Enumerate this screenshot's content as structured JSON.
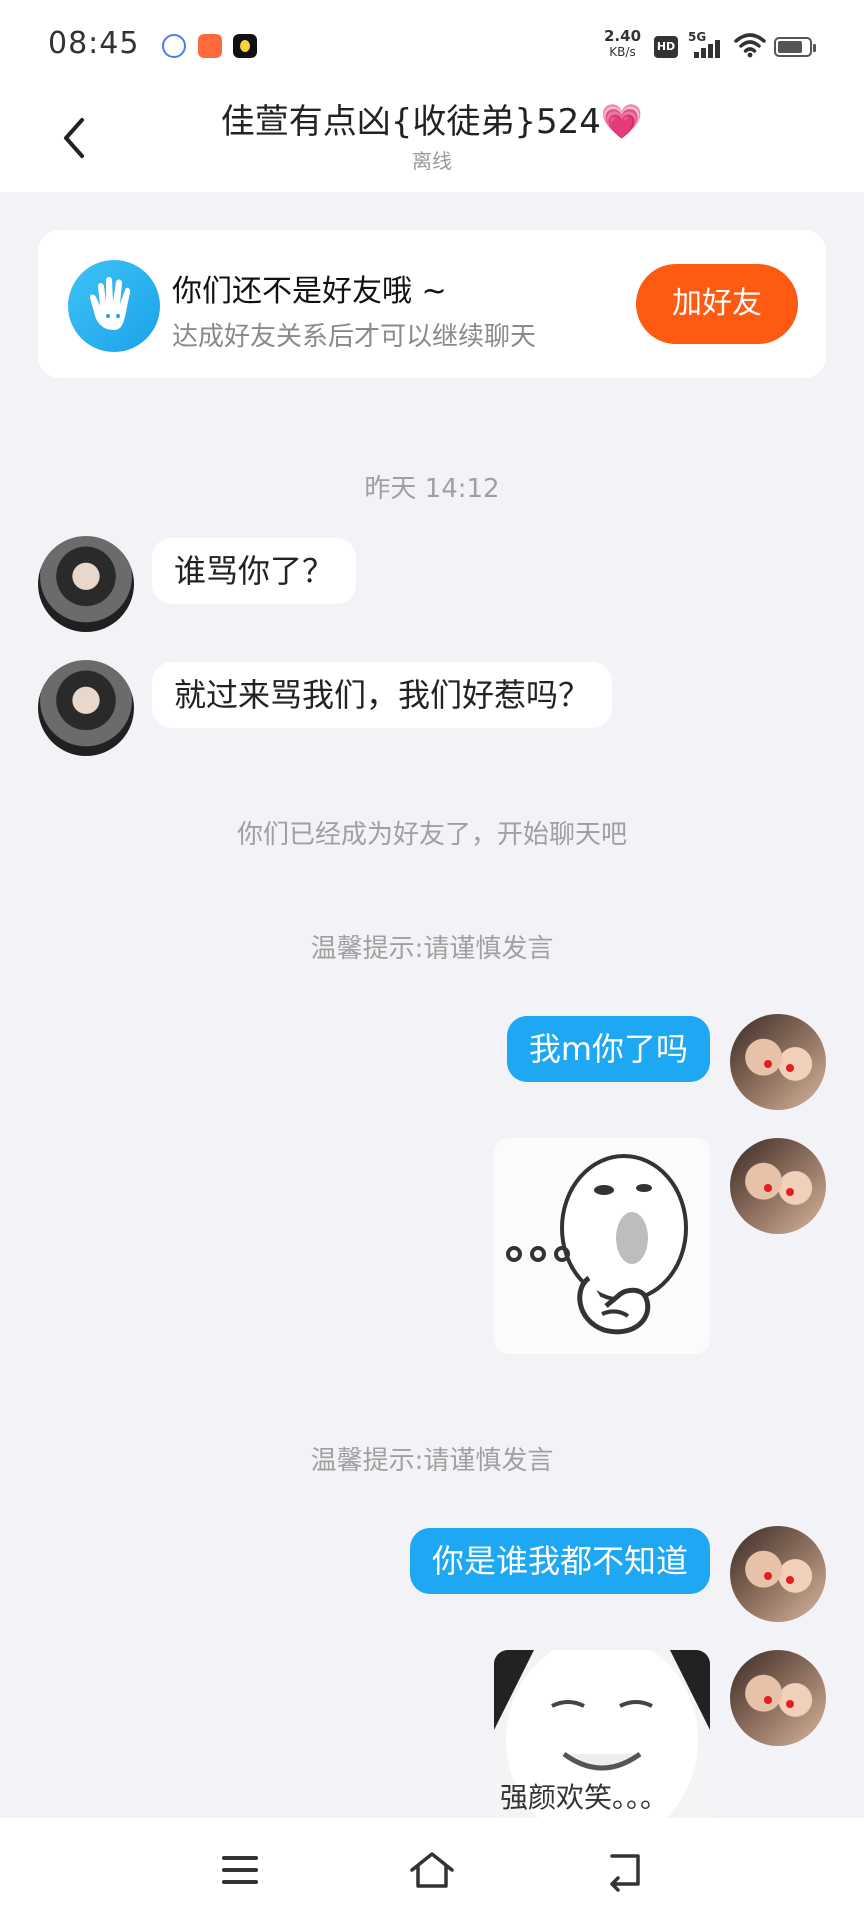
{
  "status_bar": {
    "time": "08:45",
    "net_speed_value": "2.40",
    "net_speed_unit": "KB/s",
    "hd_label": "HD",
    "signal_label": "5G"
  },
  "header": {
    "title": "佳萱有点凶{收徒弟}524",
    "title_emoji": "💗",
    "status": "离线"
  },
  "friend_banner": {
    "title": "你们还不是好友哦 ~",
    "subtitle": "达成好友关系后才可以继续聊天",
    "button_label": "加好友"
  },
  "messages": {
    "timestamp": "昨天 14:12",
    "m1": "谁骂你了？",
    "m2": "就过来骂我们，我们好惹吗？",
    "system_friends": "你们已经成为好友了，开始聊天吧",
    "tip1": "温馨提示:请谨慎发言",
    "m3": "我m你了吗",
    "tip2": "温馨提示:请谨慎发言",
    "m4": "你是谁我都不知道",
    "sticker2_caption": "强颜欢笑。。。"
  },
  "icons": {
    "back": "chevron-left-icon",
    "menu": "menu-icon",
    "home": "home-icon",
    "return": "return-icon"
  },
  "colors": {
    "accent_blue": "#1ea8f3",
    "add_friend_orange": "#ff5a12",
    "background": "#f3f3f7"
  }
}
